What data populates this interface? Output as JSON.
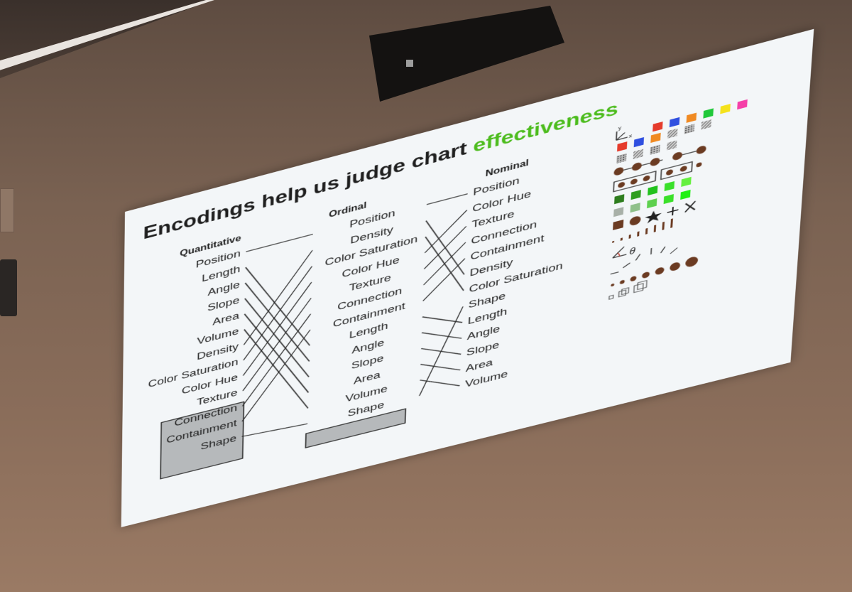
{
  "title": {
    "prefix": "Encodings help us judge chart",
    "highlight": "effectiveness"
  },
  "colors": {
    "highlight": "#4cbc1d",
    "slide_bg": "#f3f6f8",
    "box_fill": "#b6b9bb",
    "ink": "#1f1f1f"
  },
  "columns": {
    "quantitative": {
      "heading": "Quantitative",
      "items": [
        "Position",
        "Length",
        "Angle",
        "Slope",
        "Area",
        "Volume",
        "Density",
        "Color Saturation",
        "Color Hue",
        "Texture",
        "Connection",
        "Containment",
        "Shape"
      ]
    },
    "ordinal": {
      "heading": "Ordinal",
      "items": [
        "Position",
        "Density",
        "Color Saturation",
        "Color Hue",
        "Texture",
        "Connection",
        "Containment",
        "Length",
        "Angle",
        "Slope",
        "Area",
        "Volume",
        "Shape"
      ]
    },
    "nominal": {
      "heading": "Nominal",
      "items": [
        "Position",
        "Color Hue",
        "Texture",
        "Connection",
        "Containment",
        "Density",
        "Color Saturation",
        "Shape",
        "Length",
        "Angle",
        "Slope",
        "Area",
        "Volume"
      ]
    }
  },
  "axis_icon": {
    "y": "y",
    "x": "x"
  },
  "angle_symbol": "θ",
  "icon_names": [
    "axes-icon",
    "color-swatches-icon",
    "texture-swatches-icon",
    "connection-icon",
    "containment-icon",
    "density-swatches-icon",
    "saturation-swatches-icon",
    "shape-glyphs-icon",
    "length-bars-icon",
    "angle-icon",
    "slope-ticks-icon",
    "area-circles-icon",
    "volume-cubes-icon"
  ]
}
